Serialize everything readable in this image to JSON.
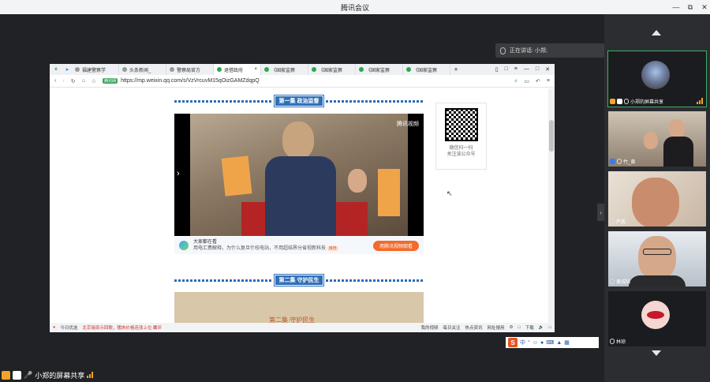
{
  "window": {
    "title": "腾讯会议"
  },
  "speaking": {
    "label": "正在讲话: 小郑;"
  },
  "browser": {
    "tabs": [
      {
        "label": "福建警察学",
        "color": "#999"
      },
      {
        "label": "头条新闻_",
        "color": "#999"
      },
      {
        "label": "警察局官方",
        "color": "#999"
      },
      {
        "label": "退借政府",
        "color": "#2ba84a",
        "active": true
      },
      {
        "label": "《国家监察",
        "color": "#2ba84a"
      },
      {
        "label": "《国家监察",
        "color": "#2ba84a"
      },
      {
        "label": "《国家监察",
        "color": "#2ba84a"
      },
      {
        "label": "《国家监察",
        "color": "#2ba84a"
      }
    ],
    "site_badge": "腾讯网",
    "url": "https://mp.weixin.qq.com/s/VzVrcuvM15qOizGAMZdqpQ"
  },
  "article": {
    "episode1": "第一集 政治监督",
    "episode2": "第二集 守护民生",
    "video_logo": "腾讯视频",
    "ad_title": "大家都在看",
    "ad_sub": "用电汇费解释，为什么复旦什校电站，不用超结界分省视新科技",
    "ad_tag": "推荐",
    "ad_button": "用腾讯视频观看",
    "still_caption": "第二集 守护民生",
    "qr_text1": "微信扫一扫",
    "qr_text2": "关注该公众号"
  },
  "statusbar": {
    "left": "今日优选",
    "news": "北京瑞资示回歌，猪肉价格连涨上位 瞩评",
    "items": [
      "我的视频",
      "每日关注",
      "热点资讯",
      "网址搜用",
      "下载"
    ]
  },
  "ime": {
    "brand": "S",
    "lang": "中"
  },
  "share": {
    "label": "小郑的屏幕共享"
  },
  "participants": [
    {
      "name": "小郑的屏幕共享"
    },
    {
      "name": "竹_黄"
    },
    {
      "name": "严武"
    },
    {
      "name": "黄成陆"
    },
    {
      "name": "林琼"
    }
  ],
  "colors": {
    "accent_green": "#3fae6b",
    "signal": "#f2a32a",
    "bg": "#202225"
  }
}
